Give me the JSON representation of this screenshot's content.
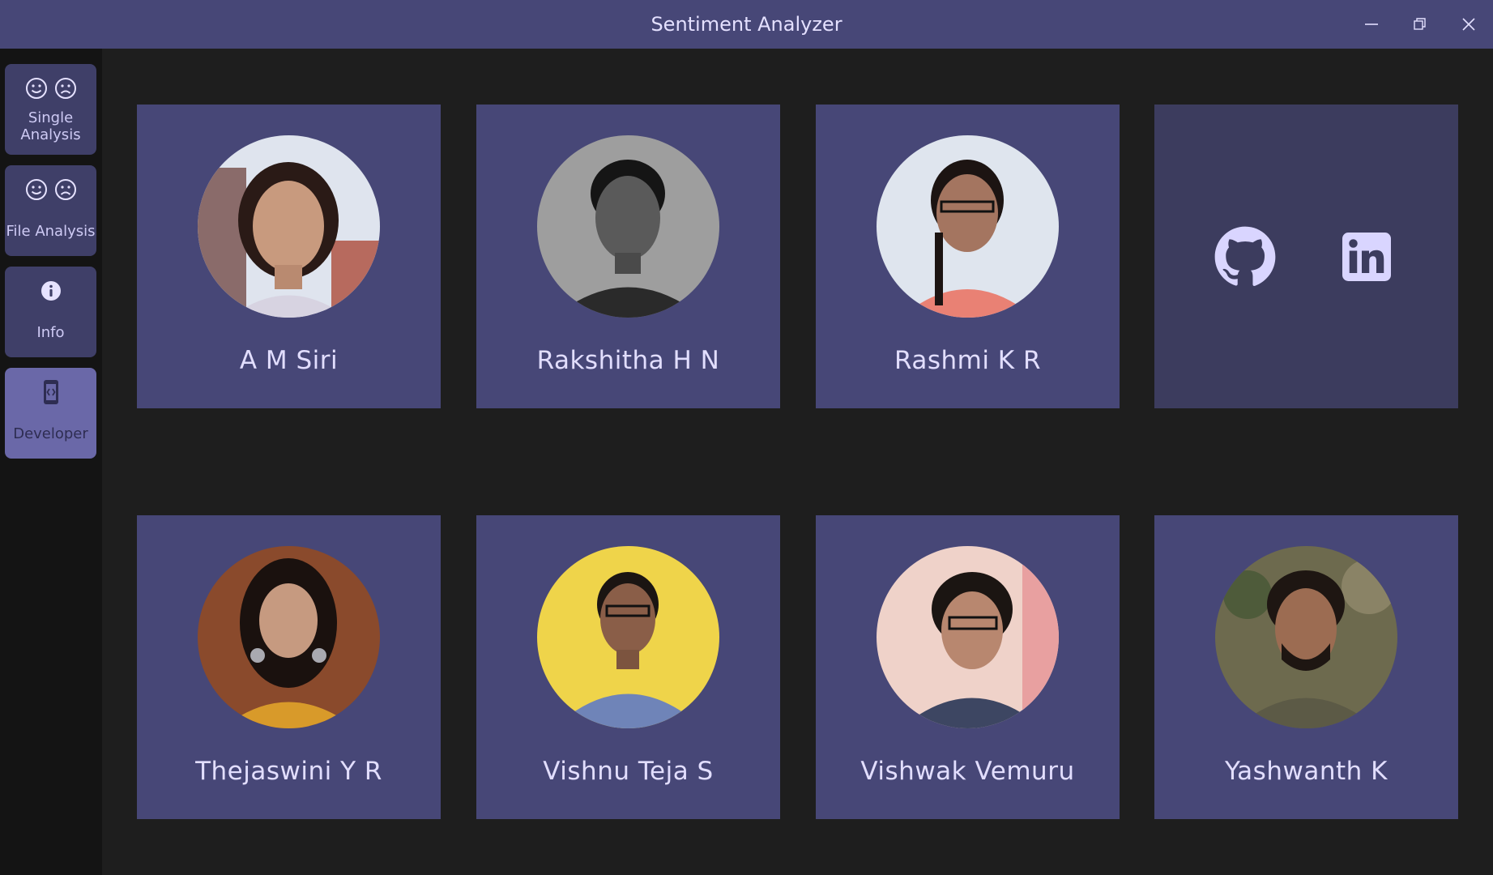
{
  "window": {
    "title": "Sentiment Analyzer"
  },
  "sidebar": {
    "items": [
      {
        "label": "Single Analysis",
        "icon": "smiley-frowny-icons",
        "active": false
      },
      {
        "label": "File Analysis",
        "icon": "smiley-frowny-icons",
        "active": false
      },
      {
        "label": "Info",
        "icon": "info-icon",
        "active": false
      },
      {
        "label": "Developer",
        "icon": "developer-icon",
        "active": true
      }
    ]
  },
  "developers": [
    {
      "name": "A M Siri"
    },
    {
      "name": "Rakshitha H N"
    },
    {
      "name": "Rashmi K R"
    },
    {
      "name": "Thejaswini Y R"
    },
    {
      "name": "Vishnu Teja S"
    },
    {
      "name": "Vishwak Vemuru"
    },
    {
      "name": "Yashwanth K"
    }
  ],
  "social": [
    {
      "icon": "github-icon"
    },
    {
      "icon": "linkedin-icon"
    }
  ],
  "colors": {
    "titlebar": "#474777",
    "card": "#474777",
    "social_card": "#3c3c5e",
    "sidebar_item": "#3f3f68",
    "sidebar_active": "#6a68a8",
    "background": "#1e1e1e",
    "text": "#dcd8ff"
  }
}
